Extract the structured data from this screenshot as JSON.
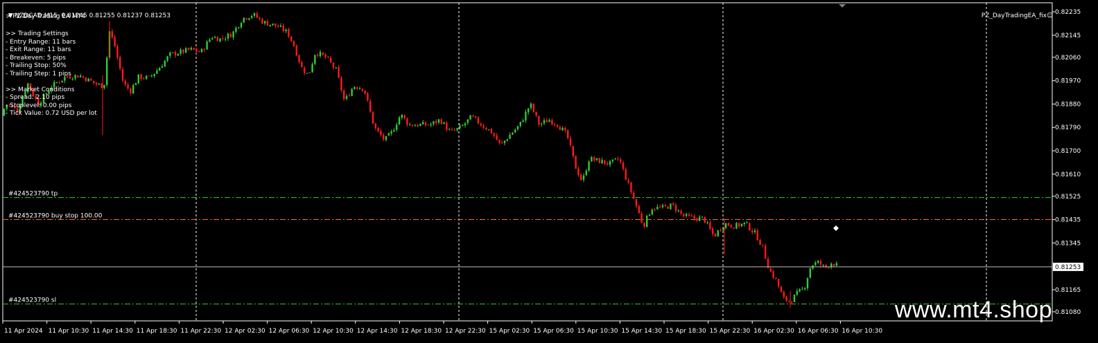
{
  "window": {
    "symbol_line": "NZDCAD,M15  0.81245 0.81255 0.81237 0.81253",
    "ea_name_line": "> PZ Day Trading EA MT4",
    "ea_tag": "PZ_DayTradingEA_fix"
  },
  "settings_panel": {
    "lines": [
      ">> Trading Settings",
      "- Entry Range: 11 bars",
      "- Exit Range: 11 bars",
      "- Breakeven: 5 pips",
      "- Trailing Stop: 50%",
      "- Trailing Step: 1 pips",
      "",
      ">> Market Conditions",
      "- Spread: 2.10 pips",
      "- Stoplevel: 0.00 pips",
      "- Tick Value: 0.72 USD per lot"
    ]
  },
  "order_lines": [
    {
      "label": "#424523790 tp",
      "price": 0.8152,
      "color": "#33cc33"
    },
    {
      "label": "#424523790 buy stop 100.00",
      "price": 0.81435,
      "color": "#ff6633"
    },
    {
      "label": "#424523790 sl",
      "price": 0.8111,
      "color": "#33cc33"
    }
  ],
  "current_price": {
    "value": "0.81253",
    "price": 0.81253
  },
  "watermark": "www.mt4.shop",
  "colors": {
    "bull": "#33cc33",
    "bear": "#ff1a1a",
    "axis": "#ffffff",
    "bg": "#000000"
  },
  "chart_data": {
    "type": "candlestick",
    "symbol": "NZDCAD",
    "timeframe": "M15",
    "ylim": [
      0.81045,
      0.8227
    ],
    "y_ticks": [
      "0.82235",
      "0.82145",
      "0.82060",
      "0.81970",
      "0.81880",
      "0.81790",
      "0.81700",
      "0.81610",
      "0.81525",
      "0.81435",
      "0.81345",
      "0.81253",
      "0.81165",
      "0.81080"
    ],
    "x_ticks": [
      "11 Apr 2024",
      "11 Apr 10:30",
      "11 Apr 14:30",
      "11 Apr 18:30",
      "11 Apr 22:30",
      "12 Apr 02:30",
      "12 Apr 06:30",
      "12 Apr 10:30",
      "12 Apr 14:30",
      "12 Apr 18:30",
      "12 Apr 22:30",
      "15 Apr 02:30",
      "15 Apr 06:30",
      "15 Apr 10:30",
      "15 Apr 14:30",
      "15 Apr 18:30",
      "15 Apr 22:30",
      "16 Apr 02:30",
      "16 Apr 06:30",
      "16 Apr 10:30"
    ],
    "period_separators": [
      "11 Apr 22:30",
      "12 Apr 22:30",
      "15 Apr 22:30"
    ],
    "close_path": [
      [
        0,
        0.81835
      ],
      [
        10,
        0.8188
      ],
      [
        25,
        0.81855
      ],
      [
        40,
        0.8196
      ],
      [
        55,
        0.8188
      ],
      [
        75,
        0.8195
      ],
      [
        95,
        0.81985
      ],
      [
        115,
        0.8199
      ],
      [
        140,
        0.81955
      ],
      [
        150,
        0.8195
      ],
      [
        158,
        0.8216
      ],
      [
        165,
        0.8211
      ],
      [
        178,
        0.8196
      ],
      [
        188,
        0.8193
      ],
      [
        200,
        0.81985
      ],
      [
        215,
        0.8198
      ],
      [
        230,
        0.8202
      ],
      [
        245,
        0.8207
      ],
      [
        260,
        0.8208
      ],
      [
        275,
        0.8209
      ],
      [
        290,
        0.8208
      ],
      [
        305,
        0.8214
      ],
      [
        318,
        0.8213
      ],
      [
        335,
        0.8215
      ],
      [
        350,
        0.8221
      ],
      [
        365,
        0.82225
      ],
      [
        380,
        0.82195
      ],
      [
        400,
        0.8218
      ],
      [
        415,
        0.82155
      ],
      [
        425,
        0.821
      ],
      [
        435,
        0.8202
      ],
      [
        445,
        0.8199
      ],
      [
        455,
        0.8208
      ],
      [
        470,
        0.8206
      ],
      [
        485,
        0.8201
      ],
      [
        497,
        0.8189
      ],
      [
        510,
        0.8195
      ],
      [
        525,
        0.8194
      ],
      [
        540,
        0.8179
      ],
      [
        555,
        0.8174
      ],
      [
        565,
        0.8177
      ],
      [
        578,
        0.8184
      ],
      [
        590,
        0.818
      ],
      [
        605,
        0.818
      ],
      [
        620,
        0.818
      ],
      [
        635,
        0.8182
      ],
      [
        650,
        0.8177
      ],
      [
        665,
        0.8179
      ],
      [
        680,
        0.8183
      ],
      [
        695,
        0.818
      ],
      [
        710,
        0.8177
      ],
      [
        722,
        0.8172
      ],
      [
        735,
        0.8176
      ],
      [
        750,
        0.818
      ],
      [
        765,
        0.8188
      ],
      [
        778,
        0.818
      ],
      [
        792,
        0.8182
      ],
      [
        805,
        0.818
      ],
      [
        818,
        0.8176
      ],
      [
        830,
        0.8164
      ],
      [
        840,
        0.8158
      ],
      [
        850,
        0.8167
      ],
      [
        865,
        0.8166
      ],
      [
        880,
        0.8165
      ],
      [
        893,
        0.8167
      ],
      [
        905,
        0.8158
      ],
      [
        915,
        0.8151
      ],
      [
        928,
        0.8141
      ],
      [
        940,
        0.8148
      ],
      [
        955,
        0.8148
      ],
      [
        970,
        0.8149
      ],
      [
        985,
        0.8145
      ],
      [
        1000,
        0.8144
      ],
      [
        1015,
        0.8144
      ],
      [
        1030,
        0.8137
      ],
      [
        1045,
        0.8142
      ],
      [
        1060,
        0.8141
      ],
      [
        1075,
        0.8142
      ],
      [
        1090,
        0.8138
      ],
      [
        1100,
        0.8133
      ],
      [
        1110,
        0.8124
      ],
      [
        1120,
        0.812
      ],
      [
        1130,
        0.8113
      ],
      [
        1140,
        0.8112
      ],
      [
        1150,
        0.8115
      ],
      [
        1160,
        0.8117
      ],
      [
        1170,
        0.8126
      ],
      [
        1180,
        0.8127
      ],
      [
        1190,
        0.8125
      ],
      [
        1200,
        0.8127
      ],
      [
        1210,
        0.81253
      ]
    ]
  }
}
